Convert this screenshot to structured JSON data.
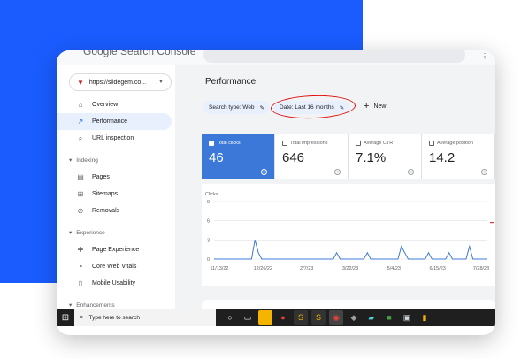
{
  "app": {
    "logo_text": "Google Search Console"
  },
  "sidebar": {
    "property": "https://slidegem.co...",
    "items": [
      {
        "label": "Overview",
        "icon": "home-icon"
      },
      {
        "label": "Performance",
        "icon": "trending-up-icon"
      },
      {
        "label": "URL inspection",
        "icon": "search-icon"
      }
    ],
    "sections": [
      {
        "label": "Indexing",
        "items": [
          {
            "label": "Pages",
            "icon": "pages-icon"
          },
          {
            "label": "Sitemaps",
            "icon": "sitemap-icon"
          },
          {
            "label": "Removals",
            "icon": "removals-icon"
          }
        ]
      },
      {
        "label": "Experience",
        "items": [
          {
            "label": "Page Experience",
            "icon": "page-experience-icon"
          },
          {
            "label": "Core Web Vitals",
            "icon": "speedometer-icon"
          },
          {
            "label": "Mobile Usability",
            "icon": "mobile-icon"
          }
        ]
      },
      {
        "label": "Enhancements",
        "items": []
      }
    ]
  },
  "main": {
    "title": "Performance",
    "filters": {
      "search_type": "Search type: Web",
      "date": "Date: Last 16 months",
      "new_label": "New"
    },
    "metrics": [
      {
        "label": "Total clicks",
        "value": "46",
        "active": true
      },
      {
        "label": "Total impressions",
        "value": "646",
        "active": false
      },
      {
        "label": "Average CTR",
        "value": "7.1%",
        "active": false
      },
      {
        "label": "Average position",
        "value": "14.2",
        "active": false
      }
    ]
  },
  "chart_data": {
    "type": "line",
    "ylabel": "Clicks",
    "yticks": [
      "9",
      "6",
      "3",
      "0"
    ],
    "ylim": [
      0,
      9
    ],
    "x_tick_labels": [
      "11/13/22",
      "12/26/22",
      "2/7/23",
      "3/22/23",
      "5/4/23",
      "6/15/23",
      "7/28/23"
    ],
    "series": [
      {
        "color": "#3c78d8",
        "x": [
          0,
          4,
          8,
          11,
          12,
          13,
          14,
          18,
          22,
          26,
          30,
          35,
          36,
          37,
          40,
          44,
          45,
          46,
          50,
          54,
          55,
          56,
          57,
          60,
          62,
          63,
          64,
          66,
          68,
          69,
          70,
          72,
          74,
          75,
          76,
          78,
          80
        ],
        "values": [
          0,
          0,
          0,
          0,
          3,
          1,
          0,
          0,
          0,
          0,
          0,
          0,
          1,
          0,
          0,
          0,
          1,
          0,
          0,
          0,
          2,
          1,
          0,
          0,
          0,
          1,
          0,
          0,
          0,
          1,
          0,
          0,
          0,
          2,
          0,
          0,
          0
        ]
      }
    ]
  },
  "taskbar": {
    "search_placeholder": "Type here to search",
    "icons": [
      "windows-start-icon",
      "cortana-circle-icon",
      "task-view-icon",
      "file-explorer-icon",
      "app-drop-icon",
      "app-s-icon",
      "app-s2-icon",
      "chrome-icon",
      "app-gem-icon",
      "app-note-icon",
      "app-green-icon",
      "app-printer-icon",
      "app-chart-icon"
    ]
  },
  "colors": {
    "accent": "#1a5cff",
    "active_metric": "#3c78d8",
    "annotation": "#e01010"
  }
}
